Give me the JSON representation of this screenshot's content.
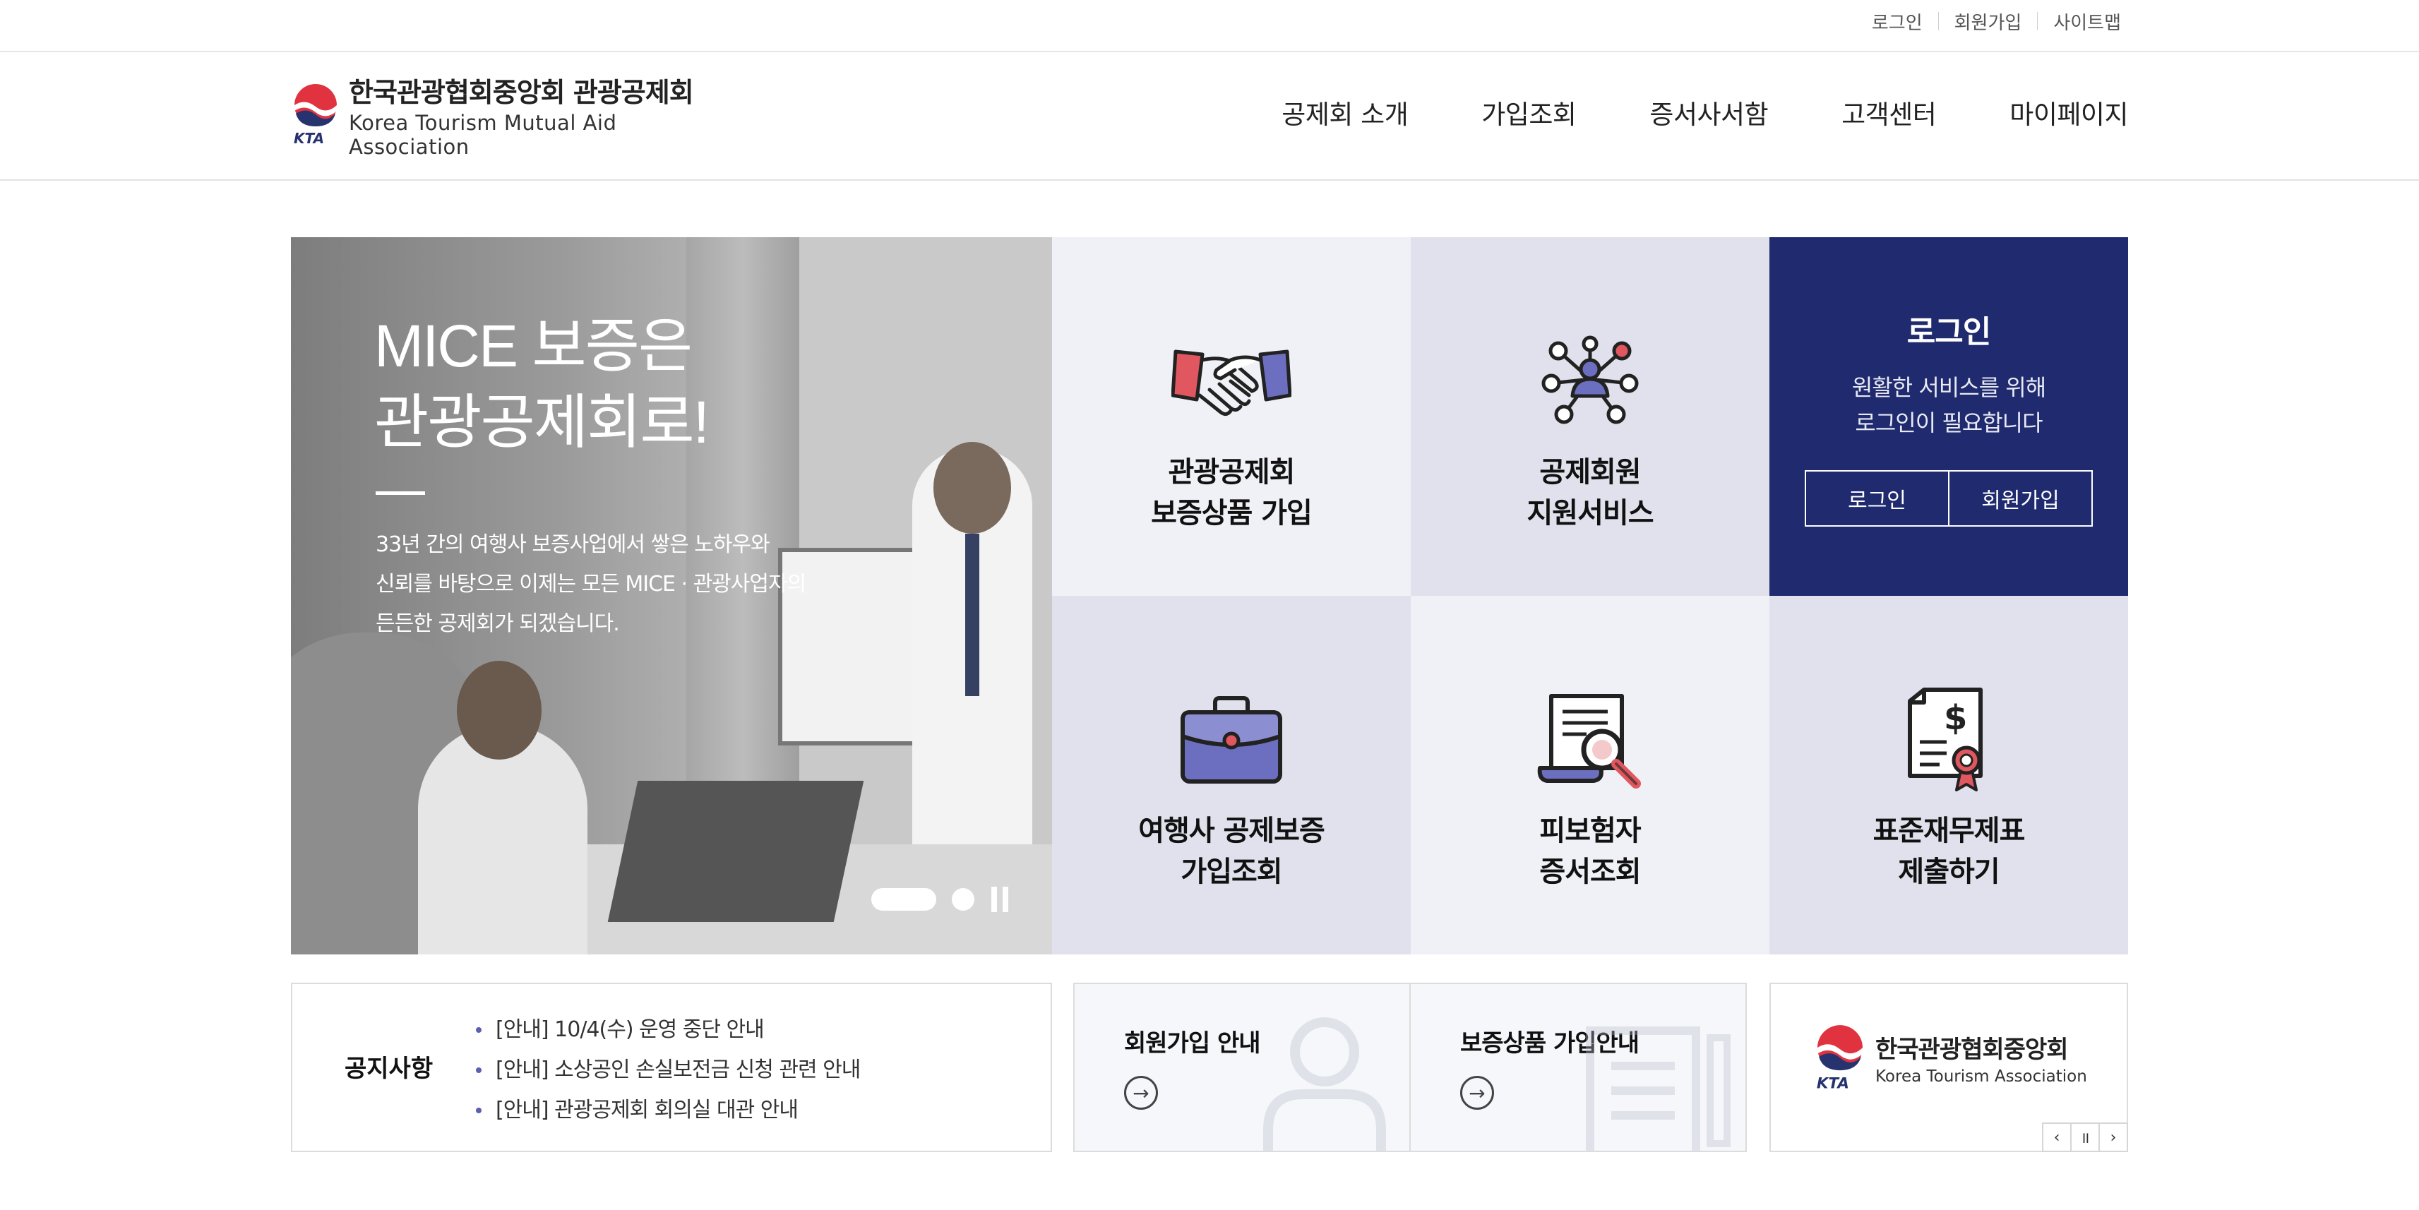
{
  "utility_nav": {
    "login": "로그인",
    "signup": "회원가입",
    "sitemap": "사이트맵"
  },
  "header": {
    "logo_ko": "한국관광협회중앙회 관광공제회",
    "logo_en": "Korea Tourism Mutual Aid Association",
    "logo_mark_text": "KTA",
    "menu": [
      {
        "label": "공제회 소개"
      },
      {
        "label": "가입조회"
      },
      {
        "label": "증서사서함"
      },
      {
        "label": "고객센터"
      },
      {
        "label": "마이페이지"
      }
    ]
  },
  "banner": {
    "title_line1": "MICE 보증은",
    "title_line2": "관광공제회로!",
    "desc_line1": "33년 간의 여행사 보증사업에서 쌓은 노하우와",
    "desc_line2": "신뢰를 바탕으로 이제는 모든 MICE · 관광사업자의",
    "desc_line3": "든든한 공제회가 되겠습니다."
  },
  "tiles": {
    "guarantee_product": {
      "label": "관광공제회\n보증상품 가입",
      "icon": "handshake-icon"
    },
    "member_support": {
      "label": "공제회원\n지원서비스",
      "icon": "network-icon"
    },
    "travel_agency_inquiry": {
      "label": "여행사 공제보증\n가입조회",
      "icon": "briefcase-icon"
    },
    "insured_certificate": {
      "label": "피보험자\n증서조회",
      "icon": "document-search-icon"
    },
    "financial_statement": {
      "label": "표준재무제표\n제출하기",
      "icon": "certificate-dollar-icon"
    }
  },
  "login_box": {
    "title": "로그인",
    "message": "원활한 서비스를 위해\n로그인이 필요합니다",
    "login_button": "로그인",
    "signup_button": "회원가입"
  },
  "notice": {
    "title": "공지사항",
    "items": [
      "[안내] 10/4(수) 운영 중단 안내",
      "[안내] 소상공인 손실보전금 신청 관련 안내",
      "[안내] 관광공제회 회의실 대관 안내"
    ]
  },
  "guides": {
    "signup_guide": "회원가입 안내",
    "product_guide": "보증상품 가입안내"
  },
  "partner": {
    "name_ko": "한국관광협회중앙회",
    "name_en": "Korea Tourism Association",
    "mark_text": "KTA"
  },
  "colors": {
    "brand_navy": "#1f2a6f",
    "tile_light": "#f0f1f6",
    "tile_mid": "#e0e1ec",
    "accent_red": "#e1575f",
    "accent_purple": "#6c6fbf"
  }
}
